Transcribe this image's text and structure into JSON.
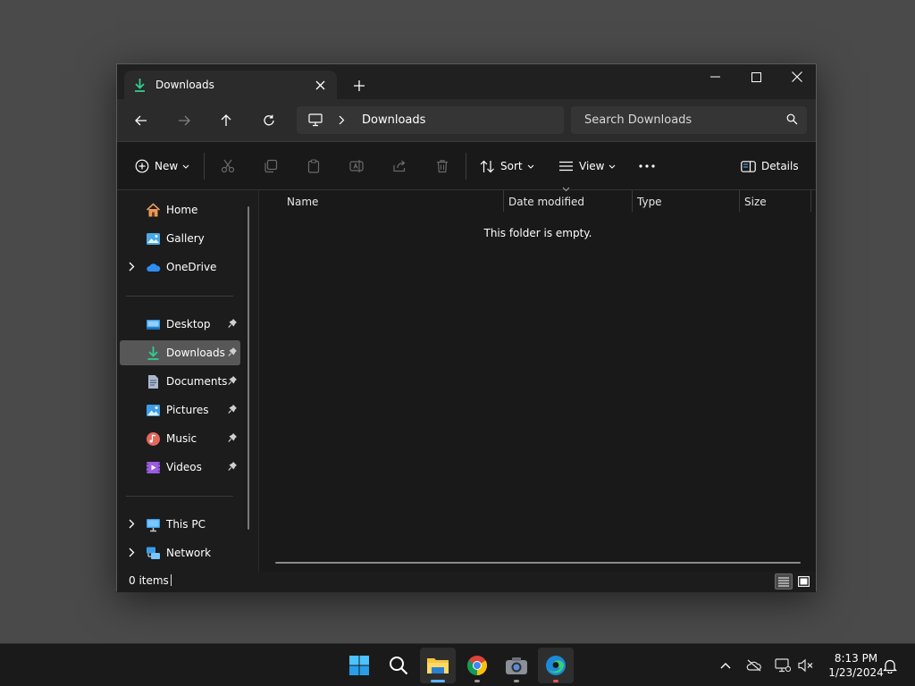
{
  "window": {
    "tab_title": "Downloads",
    "address": "Downloads",
    "search_placeholder": "Search Downloads"
  },
  "toolbar": {
    "new_label": "New",
    "sort_label": "Sort",
    "view_label": "View",
    "details_label": "Details"
  },
  "sidebar": {
    "items": [
      {
        "label": "Home",
        "icon": "home-icon"
      },
      {
        "label": "Gallery",
        "icon": "gallery-icon"
      },
      {
        "label": "OneDrive",
        "icon": "onedrive-icon"
      },
      {
        "label": "Desktop",
        "icon": "desktop-icon"
      },
      {
        "label": "Downloads",
        "icon": "downloads-icon"
      },
      {
        "label": "Documents",
        "icon": "documents-icon"
      },
      {
        "label": "Pictures",
        "icon": "pictures-icon"
      },
      {
        "label": "Music",
        "icon": "music-icon"
      },
      {
        "label": "Videos",
        "icon": "videos-icon"
      },
      {
        "label": "This PC",
        "icon": "this-pc-icon"
      },
      {
        "label": "Network",
        "icon": "network-icon"
      }
    ]
  },
  "columns": [
    "Name",
    "Date modified",
    "Type",
    "Size"
  ],
  "content": {
    "empty_message": "This folder is empty."
  },
  "status": {
    "items": "0 items"
  },
  "taskbar": {
    "time": "8:13 PM",
    "date": "1/23/2024"
  },
  "colors": {
    "accent": "#5fb2ff",
    "download_green": "#2fcf8f",
    "selected": "#575757"
  }
}
